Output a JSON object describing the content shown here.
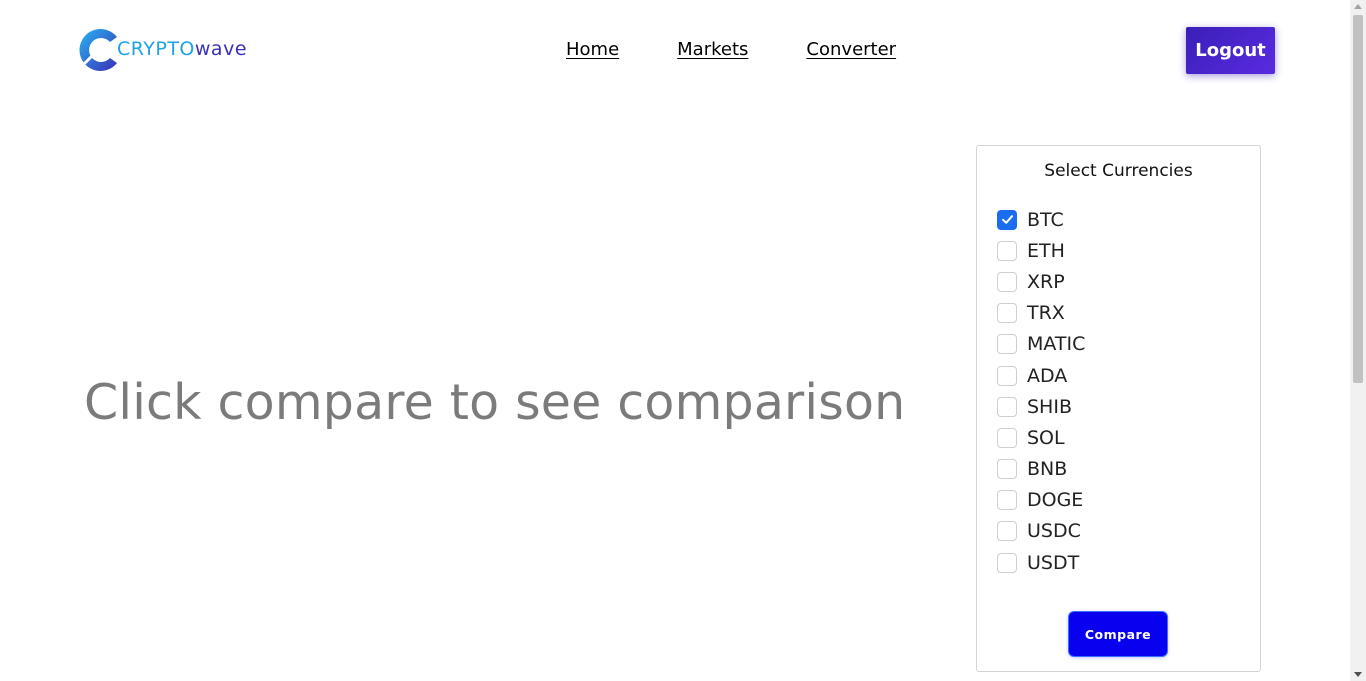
{
  "brand": {
    "logo_text_part1": "CRYPTO",
    "logo_text_part2": "wave",
    "colors": {
      "primary": "#1fa2e8",
      "secondary": "#3a2fb8"
    }
  },
  "nav": {
    "items": [
      {
        "label": "Home"
      },
      {
        "label": "Markets"
      },
      {
        "label": "Converter"
      }
    ]
  },
  "header": {
    "logout_label": "Logout"
  },
  "main": {
    "placeholder_text": "Click compare to see comparison"
  },
  "panel": {
    "title": "Select Currencies",
    "currencies": [
      {
        "label": "BTC",
        "checked": true
      },
      {
        "label": "ETH",
        "checked": false
      },
      {
        "label": "XRP",
        "checked": false
      },
      {
        "label": "TRX",
        "checked": false
      },
      {
        "label": "MATIC",
        "checked": false
      },
      {
        "label": "ADA",
        "checked": false
      },
      {
        "label": "SHIB",
        "checked": false
      },
      {
        "label": "SOL",
        "checked": false
      },
      {
        "label": "BNB",
        "checked": false
      },
      {
        "label": "DOGE",
        "checked": false
      },
      {
        "label": "USDC",
        "checked": false
      },
      {
        "label": "USDT",
        "checked": false
      }
    ],
    "compare_label": "Compare",
    "accent_color": "#1a6cf0",
    "compare_color": "#0a00f0"
  }
}
